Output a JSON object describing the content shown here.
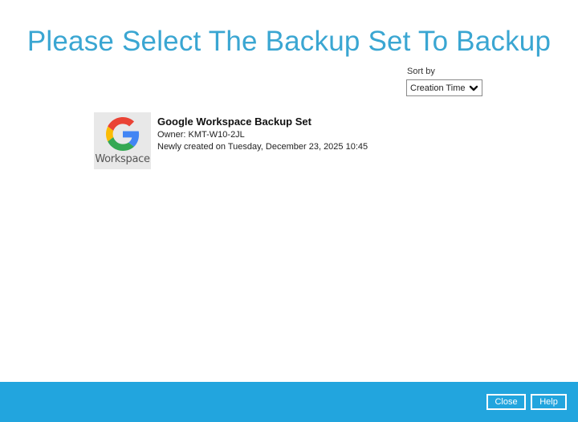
{
  "page": {
    "title": "Please Select The Backup Set To Backup"
  },
  "sort": {
    "label": "Sort by",
    "selected": "Creation Time",
    "icon": "chevron-down-icon"
  },
  "backup_sets": [
    {
      "icon": "google-workspace-logo",
      "icon_caption": "Workspace",
      "name": "Google Workspace Backup Set",
      "owner": "Owner: KMT-W10-2JL",
      "created": "Newly created on Tuesday, December 23, 2025 10:45"
    }
  ],
  "footer": {
    "close_label": "Close",
    "help_label": "Help",
    "bar_color": "#22a5de"
  },
  "colors": {
    "title": "#3aa6d2",
    "google_blue": "#4285F4",
    "google_red": "#EA4335",
    "google_yellow": "#FBBC05",
    "google_green": "#34A853"
  }
}
